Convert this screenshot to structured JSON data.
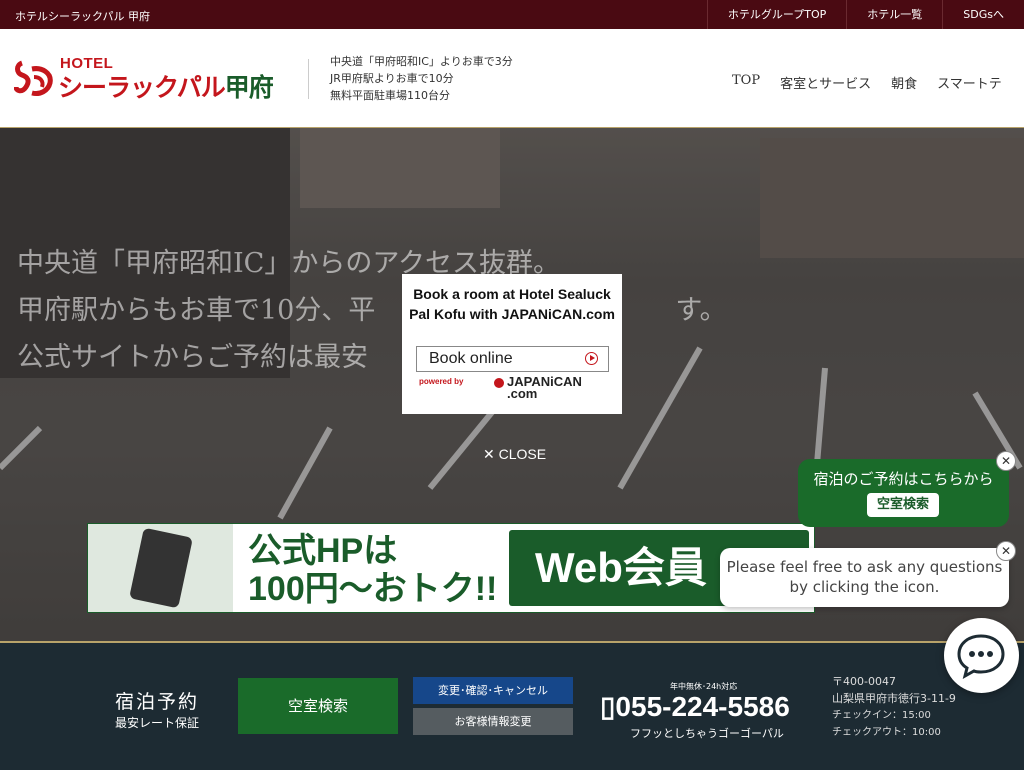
{
  "topbar": {
    "brand": "ホテルシーラックパル 甲府",
    "links": [
      "ホテルグループTOP",
      "ホテル一覧",
      "SDGsへ"
    ]
  },
  "header": {
    "logo_hotel": "HOTEL",
    "logo_name": "シーラックパル",
    "logo_city": "甲府",
    "access": [
      "中央道「甲府昭和IC」よりお車で3分",
      "JR甲府駅よりお車で10分",
      "無料平面駐車場110台分"
    ],
    "nav": [
      "TOP",
      "客室とサービス",
      "朝食",
      "スマートテ"
    ]
  },
  "hero": {
    "tagline": [
      "中央道「甲府昭和IC」からのアクセス抜群。",
      "甲府駅からもお車で10分、平",
      "公式サイトからご予約は最安"
    ],
    "tagline_end": "す。",
    "banner_text1": "公式HPは",
    "banner_text2": "100円～おトク!!",
    "banner_web": "Web会員"
  },
  "modal": {
    "title": "Book a room at Hotel Sealuck Pal Kofu with JAPANiCAN.com",
    "book_label": "Book online",
    "powered": "powered by",
    "brand": "JAPANiCAN",
    "brand_sub": ".com",
    "close_label": "CLOSE"
  },
  "green_popup": {
    "text": "宿泊のご予約はこちらから",
    "button": "空室検索"
  },
  "chat_popup": {
    "text": "Please feel free to ask any questions by clicking the icon."
  },
  "footer": {
    "label_main": "宿泊予約",
    "label_sub": "最安レート保証",
    "vacancy_button": "空室検索",
    "change_button": "変更･確認･キャンセル",
    "info_button": "お客様情報変更",
    "tel_note": "年中無休･24h対応",
    "tel": "055-224-5586",
    "tel_sub": "フフッとしちゃうゴーゴーパル",
    "address": [
      "〒400-0047",
      "山梨県甲府市徳行3-11-9"
    ],
    "checkin": "チェックイン：15:00",
    "checkout": "チェックアウト：10:00"
  }
}
